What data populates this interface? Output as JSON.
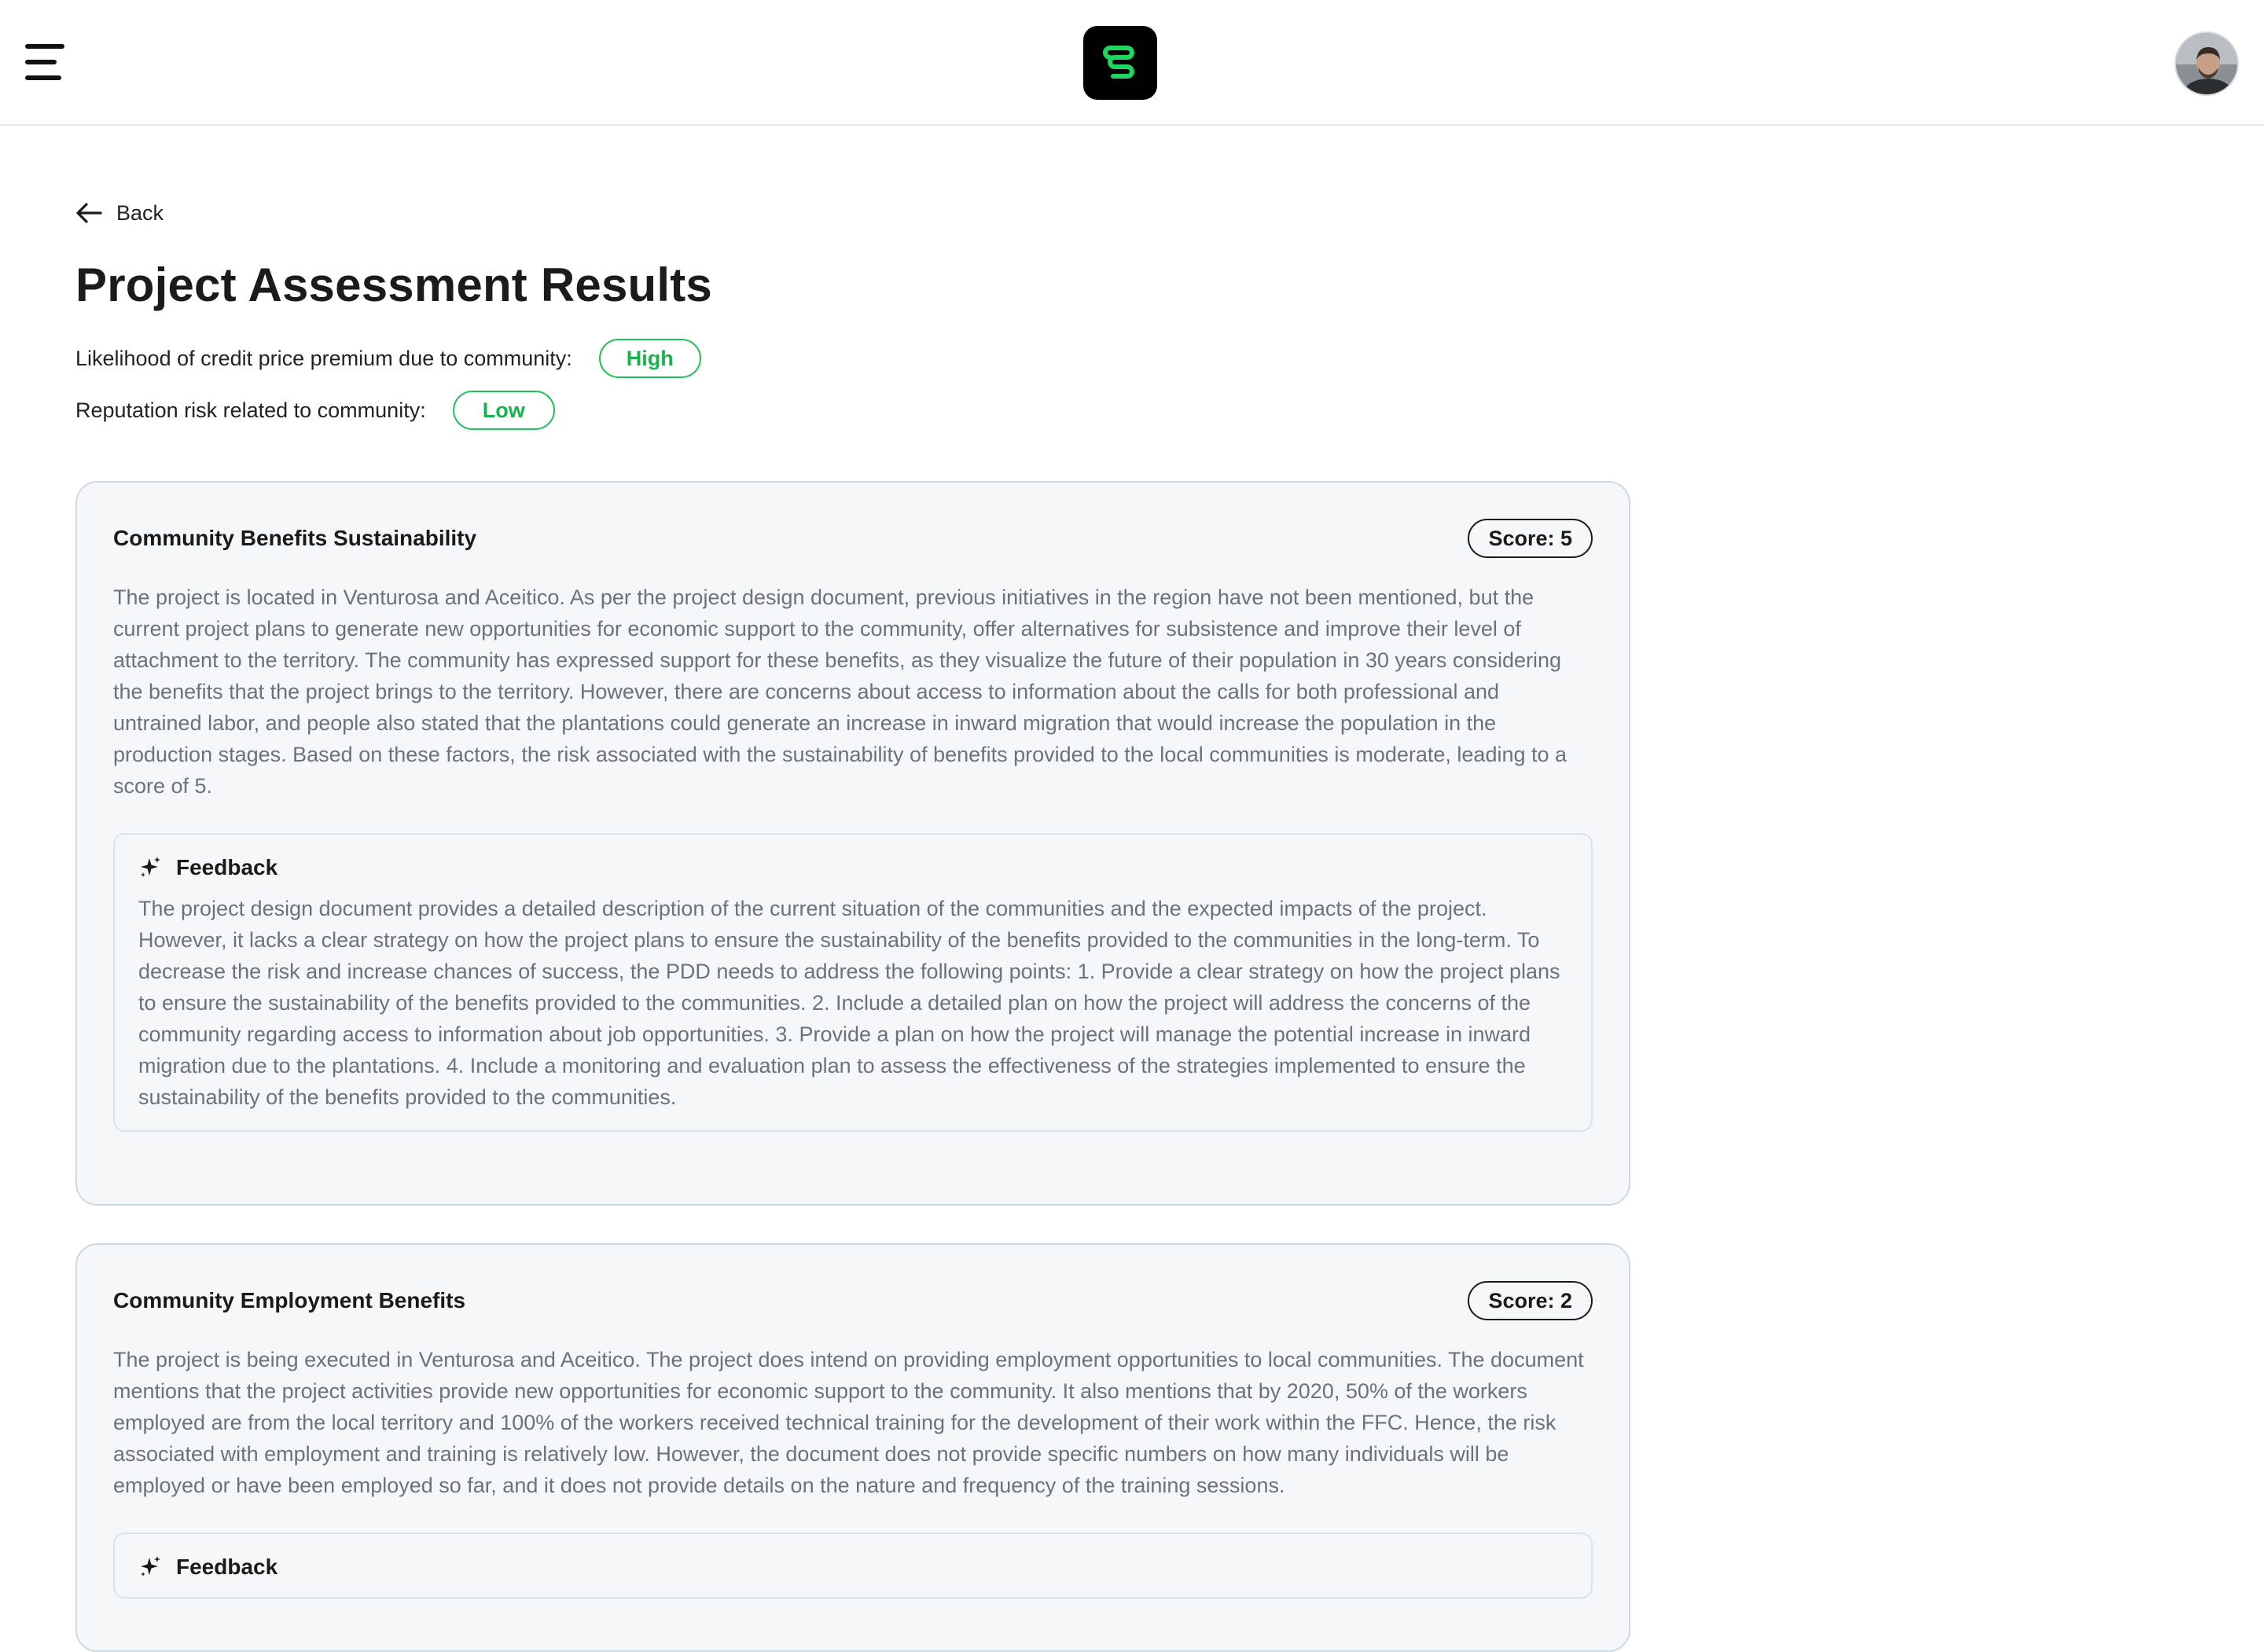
{
  "header": {
    "menu_icon": "hamburger-menu-icon",
    "logo_icon": "app-logo",
    "avatar_icon": "user-avatar"
  },
  "nav": {
    "back_label": "Back"
  },
  "page": {
    "title": "Project Assessment Results"
  },
  "metrics": [
    {
      "label": "Likelihood of credit price premium due to community:",
      "value": "High"
    },
    {
      "label": "Reputation risk related to community:",
      "value": "Low"
    }
  ],
  "sections": [
    {
      "title": "Community Benefits Sustainability",
      "score_label": "Score: 5",
      "body": "The project is located in Venturosa and Aceitico. As per the project design document, previous initiatives in the region have not been mentioned, but the current project plans to generate new opportunities for economic support to the community, offer alternatives for subsistence and improve their level of attachment to the territory. The community has expressed support for these benefits, as they visualize the future of their population in 30 years considering the benefits that the project brings to the territory. However, there are concerns about access to information about the calls for both professional and untrained labor, and people also stated that the plantations could generate an increase in inward migration that would increase the population in the production stages. Based on these factors, the risk associated with the sustainability of benefits provided to the local communities is moderate, leading to a score of 5.",
      "feedback_title": "Feedback",
      "feedback_body": "The project design document provides a detailed description of the current situation of the communities and the expected impacts of the project. However, it lacks a clear strategy on how the project plans to ensure the sustainability of the benefits provided to the communities in the long-term. To decrease the risk and increase chances of success, the PDD needs to address the following points: 1. Provide a clear strategy on how the project plans to ensure the sustainability of the benefits provided to the communities. 2. Include a detailed plan on how the project will address the concerns of the community regarding access to information about job opportunities. 3. Provide a plan on how the project will manage the potential increase in inward migration due to the plantations. 4. Include a monitoring and evaluation plan to assess the effectiveness of the strategies implemented to ensure the sustainability of the benefits provided to the communities."
    },
    {
      "title": "Community Employment Benefits",
      "score_label": "Score: 2",
      "body": "The project is being executed in Venturosa and Aceitico. The project does intend on providing employment opportunities to local communities. The document mentions that the project activities provide new opportunities for economic support to the community. It also mentions that by 2020, 50% of the workers employed are from the local territory and 100% of the workers received technical training for the development of their work within the FFC. Hence, the risk associated with employment and training is relatively low. However, the document does not provide specific numbers on how many individuals will be employed or have been employed so far, and it does not provide details on the nature and frequency of the training sessions.",
      "feedback_title": "Feedback"
    }
  ],
  "colors": {
    "accent_green": "#1fc25a",
    "card_background": "#f5f8fb",
    "body_text": "#6d7278"
  }
}
